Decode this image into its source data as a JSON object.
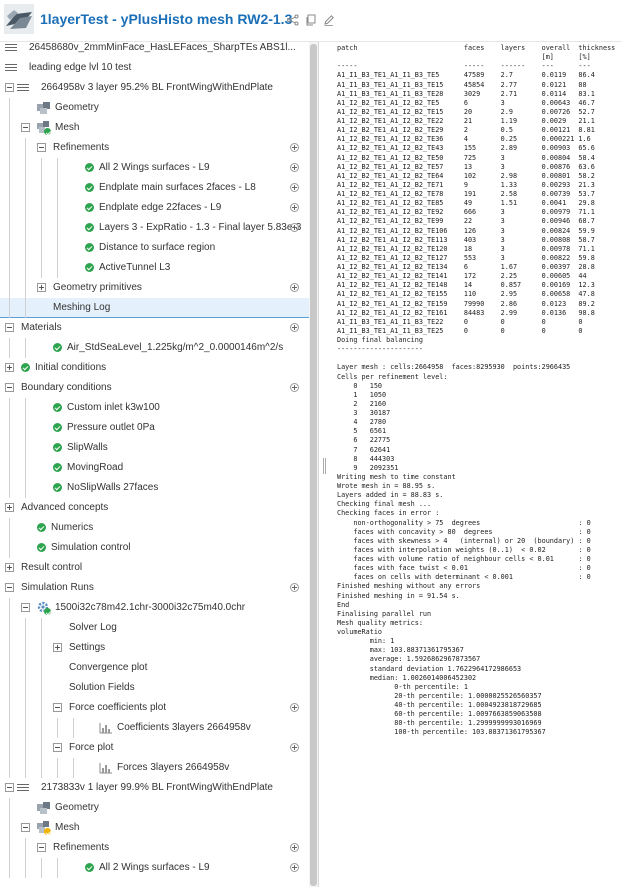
{
  "header": {
    "title": "1layerTest - yPlusHisto mesh RW2-1.3",
    "actions": [
      "share-icon",
      "copy-icon",
      "edit-icon"
    ]
  },
  "tree": [
    {
      "label": "26458680v_2mmMinFace_HasLEFaces_SharpTEs ABS1l...",
      "depth": 0,
      "ctrl": "none",
      "icon": "lines",
      "status": "none"
    },
    {
      "label": "leading edge lvl 10 test",
      "depth": 0,
      "ctrl": "none",
      "icon": "lines",
      "status": "none"
    },
    {
      "label": "2664958v 3 layer 95.2% BL FrontWingWithEndPlate",
      "depth": 0,
      "ctrl": "minus",
      "icon": "lines",
      "status": "none"
    },
    {
      "label": "Geometry",
      "depth": 1,
      "ctrl": "none",
      "icon": "geometry",
      "status": "none"
    },
    {
      "label": "Mesh",
      "depth": 1,
      "ctrl": "minus",
      "icon": "mesh",
      "status": "ok"
    },
    {
      "label": "Refinements",
      "depth": 2,
      "ctrl": "minus",
      "icon": "none",
      "status": "none",
      "add": true
    },
    {
      "label": "All 2 Wings surfaces - L9",
      "depth": 4,
      "ctrl": "none",
      "icon": "none",
      "status": "ok",
      "add": true
    },
    {
      "label": "Endplate main surfaces 2faces - L8",
      "depth": 4,
      "ctrl": "none",
      "icon": "none",
      "status": "ok",
      "add": true
    },
    {
      "label": "Endplate edge 22faces - L9",
      "depth": 4,
      "ctrl": "none",
      "icon": "none",
      "status": "ok",
      "add": true
    },
    {
      "label": "Layers 3 - ExpRatio - 1.3 - Final layer 5.83e-3",
      "depth": 4,
      "ctrl": "none",
      "icon": "none",
      "status": "ok",
      "add": true
    },
    {
      "label": "Distance to surface region",
      "depth": 4,
      "ctrl": "none",
      "icon": "none",
      "status": "ok"
    },
    {
      "label": "ActiveTunnel L3",
      "depth": 4,
      "ctrl": "none",
      "icon": "none",
      "status": "ok"
    },
    {
      "label": "Geometry primitives",
      "depth": 2,
      "ctrl": "plus",
      "icon": "none",
      "status": "none",
      "add": true
    },
    {
      "label": "Meshing Log",
      "depth": 2,
      "ctrl": "none",
      "icon": "none",
      "status": "none",
      "selected": true
    },
    {
      "label": "Materials",
      "depth": 0,
      "ctrl": "minus",
      "icon": "none",
      "status": "none",
      "add": true
    },
    {
      "label": "Air_StdSeaLevel_1.225kg/m^2_0.0000146m^2/s",
      "depth": 2,
      "ctrl": "none",
      "icon": "none",
      "status": "ok"
    },
    {
      "label": "Initial conditions",
      "depth": 0,
      "ctrl": "plus",
      "icon": "none",
      "status": "ok"
    },
    {
      "label": "Boundary conditions",
      "depth": 0,
      "ctrl": "minus",
      "icon": "none",
      "status": "none",
      "add": true
    },
    {
      "label": "Custom inlet k3w100",
      "depth": 2,
      "ctrl": "none",
      "icon": "none",
      "status": "ok"
    },
    {
      "label": "Pressure outlet 0Pa",
      "depth": 2,
      "ctrl": "none",
      "icon": "none",
      "status": "ok"
    },
    {
      "label": "SlipWalls",
      "depth": 2,
      "ctrl": "none",
      "icon": "none",
      "status": "ok"
    },
    {
      "label": "MovingRoad",
      "depth": 2,
      "ctrl": "none",
      "icon": "none",
      "status": "ok"
    },
    {
      "label": "NoSlipWalls 27faces",
      "depth": 2,
      "ctrl": "none",
      "icon": "none",
      "status": "ok"
    },
    {
      "label": "Advanced concepts",
      "depth": 0,
      "ctrl": "plus",
      "icon": "none",
      "status": "none"
    },
    {
      "label": "Numerics",
      "depth": 1,
      "ctrl": "none",
      "icon": "none",
      "status": "ok"
    },
    {
      "label": "Simulation control",
      "depth": 1,
      "ctrl": "none",
      "icon": "none",
      "status": "ok"
    },
    {
      "label": "Result control",
      "depth": 0,
      "ctrl": "plus",
      "icon": "none",
      "status": "none"
    },
    {
      "label": "Simulation Runs",
      "depth": 0,
      "ctrl": "minus",
      "icon": "none",
      "status": "none",
      "add": true
    },
    {
      "label": "1500i32c78m42.1chr-3000i32c75m40.0chr",
      "depth": 1,
      "ctrl": "minus",
      "icon": "run",
      "status": "ok"
    },
    {
      "label": "Solver Log",
      "depth": 3,
      "ctrl": "none",
      "icon": "none",
      "status": "none"
    },
    {
      "label": "Settings",
      "depth": 3,
      "ctrl": "plus",
      "icon": "none",
      "status": "none"
    },
    {
      "label": "Convergence plot",
      "depth": 3,
      "ctrl": "none",
      "icon": "none",
      "status": "none"
    },
    {
      "label": "Solution Fields",
      "depth": 3,
      "ctrl": "none",
      "icon": "none",
      "status": "none"
    },
    {
      "label": "Force coefficients plot",
      "depth": 3,
      "ctrl": "minus",
      "icon": "none",
      "status": "none",
      "add": true
    },
    {
      "label": "Coefficients 3layers 2664958v",
      "depth": 5,
      "ctrl": "none",
      "icon": "plot",
      "status": "none"
    },
    {
      "label": "Force plot",
      "depth": 3,
      "ctrl": "minus",
      "icon": "none",
      "status": "none",
      "add": true
    },
    {
      "label": "Forces 3layers 2664958v",
      "depth": 5,
      "ctrl": "none",
      "icon": "plot",
      "status": "none"
    },
    {
      "label": "2173833v 1 layer 99.9% BL FrontWingWithEndPlate",
      "depth": 0,
      "ctrl": "minus",
      "icon": "lines",
      "status": "none"
    },
    {
      "label": "Geometry",
      "depth": 1,
      "ctrl": "none",
      "icon": "geometry",
      "status": "none"
    },
    {
      "label": "Mesh",
      "depth": 1,
      "ctrl": "minus",
      "icon": "mesh",
      "status": "warn"
    },
    {
      "label": "Refinements",
      "depth": 2,
      "ctrl": "minus",
      "icon": "none",
      "status": "none",
      "add": true
    },
    {
      "label": "All 2 Wings surfaces - L9",
      "depth": 4,
      "ctrl": "none",
      "icon": "none",
      "status": "ok",
      "add": true
    }
  ],
  "log_lines": [
    "patch                          faces    layers    overall  thickness",
    "                                                  [m]      [%]",
    "-----                          -----    ------    ---      ---",
    "A1_I1_B3_TE1_A1_I1_B3_TE5      47589    2.7       0.0119   86.4",
    "A1_I1_B3_TE1_A1_I1_B3_TE15     45854    2.77      0.0121   88",
    "A1_I1_B3_TE1_A1_I1_B3_TE28     3029     2.71      0.0114   83.1",
    "A1_I2_B2_TE1_A1_I2_B2_TE5      6        3         0.00643  46.7",
    "A1_I2_B2_TE1_A1_I2_B2_TE15     20       2.9       0.00726  52.7",
    "A1_I2_B2_TE1_A1_I2_B2_TE22     21       1.19      0.0029   21.1",
    "A1_I2_B2_TE1_A1_I2_B2_TE29     2        0.5       0.00121  8.81",
    "A1_I2_B2_TE1_A1_I2_B2_TE36     4        0.25      0.000221 1.6",
    "A1_I2_B2_TE1_A1_I2_B2_TE43     155      2.89      0.00903  65.6",
    "A1_I2_B2_TE1_A1_I2_B2_TE50     725      3         0.00804  58.4",
    "A1_I2_B2_TE1_A1_I2_B2_TE57     13       3         0.00876  63.6",
    "A1_I2_B2_TE1_A1_I2_B2_TE64     102      2.98      0.00801  58.2",
    "A1_I2_B2_TE1_A1_I2_B2_TE71     9        1.33      0.00293  21.3",
    "A1_I2_B2_TE1_A1_I2_B2_TE78     191      2.58      0.00739  53.7",
    "A1_I2_B2_TE1_A1_I2_B2_TE85     49       1.51      0.0041   29.8",
    "A1_I2_B2_TE1_A1_I2_B2_TE92     666      3         0.00979  71.1",
    "A1_I2_B2_TE1_A1_I2_B2_TE99     22       3         0.00946  68.7",
    "A1_I2_B2_TE1_A1_I2_B2_TE106    126      3         0.00824  59.9",
    "A1_I2_B2_TE1_A1_I2_B2_TE113    403      3         0.00808  58.7",
    "A1_I2_B2_TE1_A1_I2_B2_TE120    18       3         0.00978  71.1",
    "A1_I2_B2_TE1_A1_I2_B2_TE127    553      3         0.00822  59.8",
    "A1_I2_B2_TE1_A1_I2_B2_TE134    6        1.67      0.00397  28.8",
    "A1_I2_B2_TE1_A1_I2_B2_TE141    172      2.25      0.00605  44",
    "A1_I2_B2_TE1_A1_I2_B2_TE148    14       0.857     0.00169  12.3",
    "A1_I2_B2_TE1_A1_I2_B2_TE155    110      2.95      0.00658  47.8",
    "A1_I2_B2_TE1_A1_I2_B2_TE159    79990    2.86      0.0123   89.2",
    "A1_I2_B2_TE1_A1_I2_B2_TE161    84483    2.99      0.0136   98.8",
    "A1_I1_B3_TE1_A1_I1_B3_TE22     0        0         0        0",
    "A1_I1_B3_TE1_A1_I1_B3_TE25     0        0         0        0",
    "Doing final balancing",
    "---------------------",
    "",
    "Layer mesh : cells:2664958  faces:8295930  points:2966435",
    "Cells per refinement level:",
    "    0   150",
    "    1   1050",
    "    2   2160",
    "    3   30187",
    "    4   2780",
    "    5   6561",
    "    6   22775",
    "    7   62641",
    "    8   444303",
    "    9   2092351",
    "Writing mesh to time constant",
    "Wrote mesh in = 88.95 s.",
    "Layers added in = 88.83 s.",
    "Checking final mesh ...",
    "Checking faces in error :",
    "    non-orthogonality > 75  degrees                        : 0",
    "    faces with concavity > 80  degrees                     : 0",
    "    faces with skewness > 4   (internal) or 20  (boundary) : 0",
    "    faces with interpolation weights (0..1)  < 0.02        : 0",
    "    faces with volume ratio of neighbour cells < 0.01      : 0",
    "    faces with face twist < 0.01                           : 0",
    "    faces on cells with determinant < 0.001                : 0",
    "Finished meshing without any errors",
    "Finished meshing in = 91.54 s.",
    "End",
    "Finalising parallel run",
    "Mesh quality metrics:",
    "volumeRatio",
    "        min: 1",
    "        max: 103.88371361795367",
    "        average: 1.5926862967873567",
    "        standard deviation 1.7622964172986653",
    "        median: 1.0026014006452302",
    "              0-th percentile: 1",
    "              20-th percentile: 1.0000025526560357",
    "              40-th percentile: 1.0004923818729685",
    "              60-th percentile: 1.0097663859063508",
    "              80-th percentile: 1.2999999993016969",
    "              100-th percentile: 103.88371361795367"
  ],
  "colors": {
    "title": "#1b6fb7",
    "check": "#2ea44f",
    "warn": "#f0b400",
    "selected_bg": "#e4f0fb",
    "selected_border": "#5aa0d8",
    "run_icon": "#5a8fc0"
  }
}
